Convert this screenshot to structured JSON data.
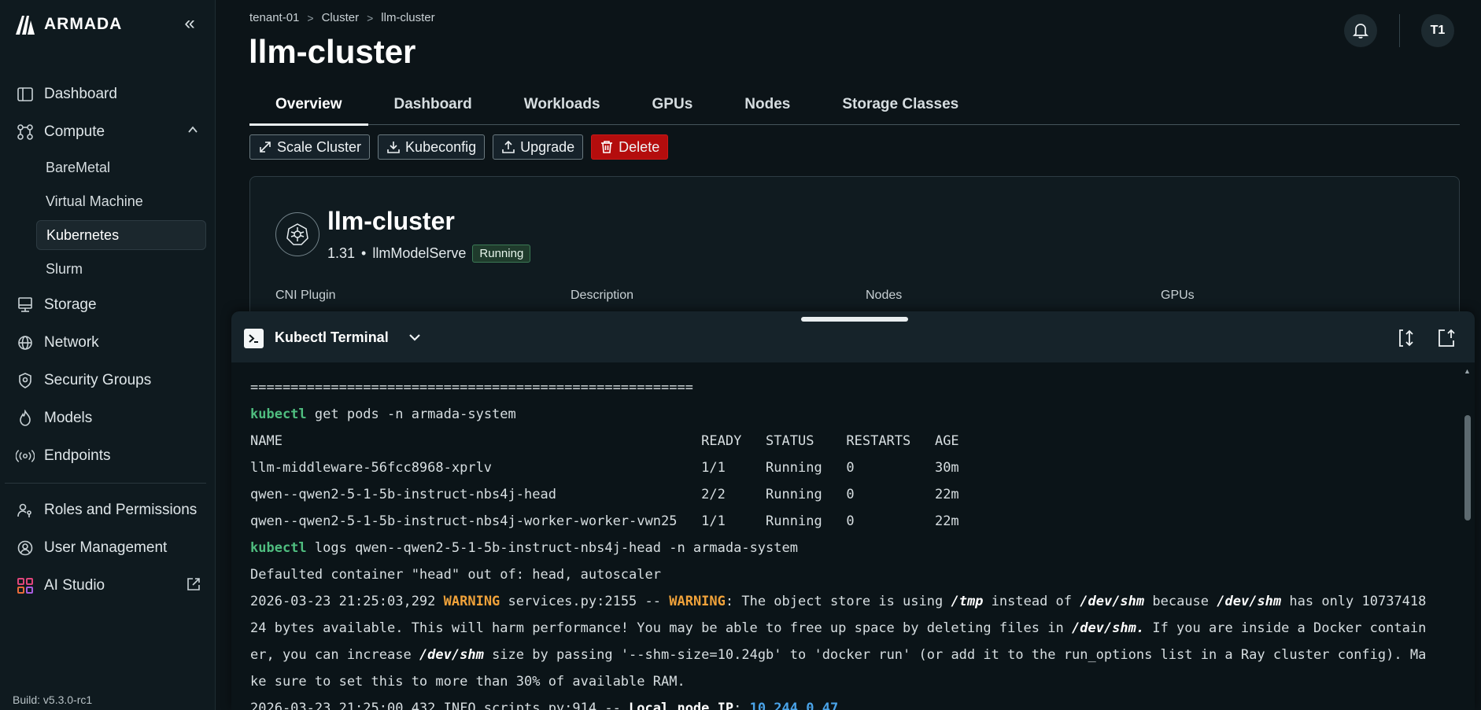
{
  "brand": {
    "name": "ARMADA",
    "collapse_glyph": "«"
  },
  "sidebar": {
    "items": [
      {
        "label": "Dashboard",
        "icon": "dashboard-icon"
      },
      {
        "label": "Compute",
        "icon": "compute-icon",
        "expanded": true,
        "children": [
          {
            "label": "BareMetal"
          },
          {
            "label": "Virtual Machine"
          },
          {
            "label": "Kubernetes",
            "active": true
          },
          {
            "label": "Slurm"
          }
        ]
      },
      {
        "label": "Storage",
        "icon": "storage-icon"
      },
      {
        "label": "Network",
        "icon": "globe-icon"
      },
      {
        "label": "Security Groups",
        "icon": "shield-icon"
      },
      {
        "label": "Models",
        "icon": "flame-icon"
      },
      {
        "label": "Endpoints",
        "icon": "broadcast-icon"
      }
    ],
    "secondary": [
      {
        "label": "Roles and Permissions",
        "icon": "key-people-icon"
      },
      {
        "label": "User Management",
        "icon": "user-gear-icon"
      },
      {
        "label": "AI Studio",
        "icon": "grid-icon",
        "external": true
      }
    ],
    "build": "Build: v5.3.0-rc1"
  },
  "header": {
    "breadcrumb": [
      "tenant-01",
      "Cluster",
      "llm-cluster"
    ],
    "title": "llm-cluster",
    "avatar_initials": "T1"
  },
  "tabs": [
    {
      "label": "Overview",
      "active": true
    },
    {
      "label": "Dashboard"
    },
    {
      "label": "Workloads"
    },
    {
      "label": "GPUs"
    },
    {
      "label": "Nodes"
    },
    {
      "label": "Storage Classes"
    }
  ],
  "actions": {
    "scale": "Scale Cluster",
    "kubeconfig": "Kubeconfig",
    "upgrade": "Upgrade",
    "delete": "Delete"
  },
  "cluster": {
    "name": "llm-cluster",
    "version": "1.31",
    "bullet": "•",
    "project": "llmModelServe",
    "status": "Running",
    "columns": [
      "CNI Plugin",
      "Description",
      "Nodes",
      "GPUs"
    ]
  },
  "colors": {
    "accent_green": "#4fbd7f",
    "warning": "#f0a23a",
    "danger": "#b40d0d",
    "link_blue": "#4aa3e8"
  },
  "terminal": {
    "title": "Kubectl Terminal",
    "lines": {
      "l0": "=======================================================",
      "l1_kw": "kubectl",
      "l1_rest": " get pods -n armada-system",
      "l2": "NAME                                                    READY   STATUS    RESTARTS   AGE",
      "l3": "llm-middleware-56fcc8968-xprlv                          1/1     Running   0          30m",
      "l4": "qwen--qwen2-5-1-5b-instruct-nbs4j-head                  2/2     Running   0          22m",
      "l5": "qwen--qwen2-5-1-5b-instruct-nbs4j-worker-worker-vwn25   1/1     Running   0          22m",
      "l6_kw": "kubectl",
      "l6_rest": " logs qwen--qwen2-5-1-5b-instruct-nbs4j-head -n armada-system",
      "l7": "Defaulted container \"head\" out of: head, autoscaler",
      "l8_a": "2026-03-23 21:25:03,292 ",
      "l8_warn1": "WARNING",
      "l8_b": " services.py:2155 -- ",
      "l8_warn2": "WARNING",
      "l8_c": ": The object store is using ",
      "l8_tmp": "/tmp",
      "l8_d": " instead of ",
      "l8_shm1": "/dev/shm",
      "l8_e": " because ",
      "l8_shm2": "/dev/shm",
      "l8_f": " has only 10737418",
      "l9_a": "24 bytes available. This will harm performance! You may be able to free up space by deleting files in ",
      "l9_shm": "/dev/shm.",
      "l9_b": " If you are inside a Docker contain",
      "l10_a": "er, you can increase ",
      "l10_shm": "/dev/shm",
      "l10_b": " size by passing '--shm-size=10.24gb' to 'docker run' (or add it to the run_options list in a Ray cluster config). Ma",
      "l11": "ke sure to set this to more than 30% of available RAM.",
      "l12_a": "2026-03-23 21:25:00,432 INFO scripts.py:914 -- ",
      "l12_bold": "Local node IP",
      "l12_b": ": ",
      "l12_ip": "10.244.0.47"
    }
  }
}
